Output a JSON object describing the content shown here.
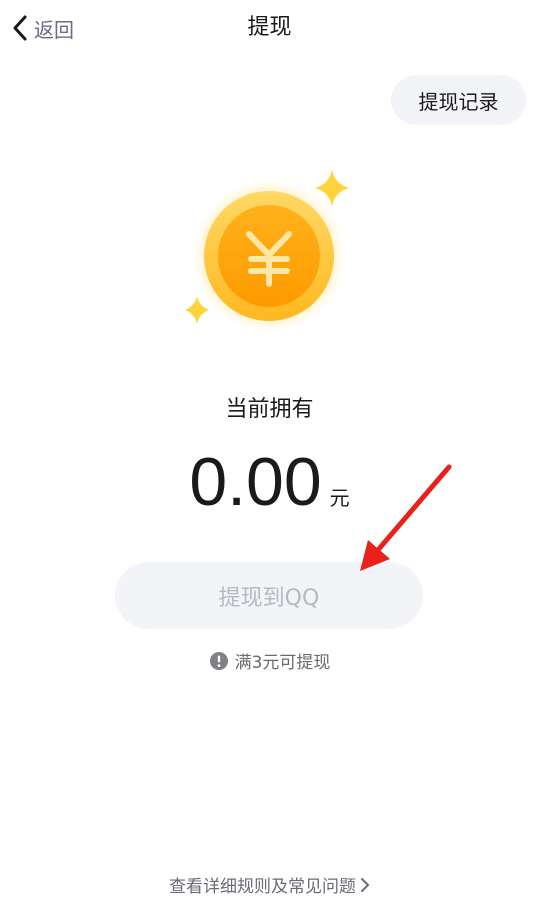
{
  "nav": {
    "back_label": "返回",
    "title": "提现"
  },
  "records_button": "提现记录",
  "coin_icon": "yuan-coin-icon",
  "balance": {
    "label": "当前拥有",
    "amount": "0.00",
    "unit": "元"
  },
  "withdraw_button": "提现到QQ",
  "hint": {
    "icon": "exclamation-circle-icon",
    "text": "满3元可提现"
  },
  "footer_link": "查看详细规则及常见问题",
  "colors": {
    "coin_gold": "#FFC21A",
    "coin_inner": "#FFA400",
    "annotation_arrow": "#E8211A",
    "button_bg": "#F3F4F8",
    "disabled_text": "#B8B8C0"
  }
}
